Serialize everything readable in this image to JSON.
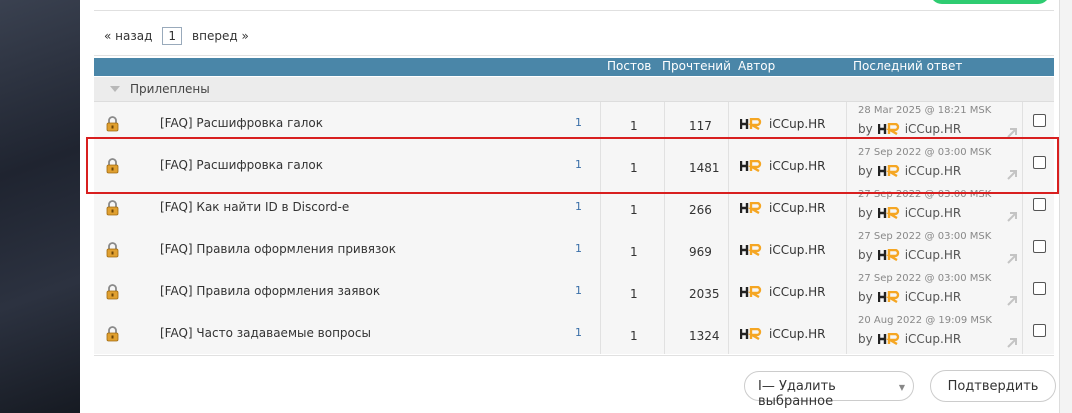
{
  "pager": {
    "prev": "« назад",
    "current": "1",
    "next": "вперед »"
  },
  "table_header": {
    "posts": "Постов",
    "views": "Прочтений",
    "author": "Автор",
    "last_reply": "Последний ответ"
  },
  "group_label": "Прилеплены",
  "rows": [
    {
      "title": "[FAQ] Расшифровка галок",
      "pages": "1",
      "posts": "1",
      "views": "117",
      "author": "iCCup.HR",
      "last_date": "28 Mar 2025 @ 18:21 MSK",
      "by": "by",
      "last_user": "iCCup.HR"
    },
    {
      "title": "[FAQ] Расшифровка галок",
      "pages": "1",
      "posts": "1",
      "views": "1481",
      "author": "iCCup.HR",
      "last_date": "27 Sep 2022 @ 03:00 MSK",
      "by": "by",
      "last_user": "iCCup.HR"
    },
    {
      "title": "[FAQ] Как найти ID в Discord-е",
      "pages": "1",
      "posts": "1",
      "views": "266",
      "author": "iCCup.HR",
      "last_date": "27 Sep 2022 @ 03:00 MSK",
      "by": "by",
      "last_user": "iCCup.HR"
    },
    {
      "title": "[FAQ] Правила оформления привязок",
      "pages": "1",
      "posts": "1",
      "views": "969",
      "author": "iCCup.HR",
      "last_date": "27 Sep 2022 @ 03:00 MSK",
      "by": "by",
      "last_user": "iCCup.HR"
    },
    {
      "title": "[FAQ] Правила оформления заявок",
      "pages": "1",
      "posts": "1",
      "views": "2035",
      "author": "iCCup.HR",
      "last_date": "27 Sep 2022 @ 03:00 MSK",
      "by": "by",
      "last_user": "iCCup.HR"
    },
    {
      "title": "[FAQ] Часто задаваемые вопросы",
      "pages": "1",
      "posts": "1",
      "views": "1324",
      "author": "iCCup.HR",
      "last_date": "20 Aug 2022 @ 19:09 MSK",
      "by": "by",
      "last_user": "iCCup.HR"
    }
  ],
  "actions": {
    "select_value": "I— Удалить выбранное",
    "confirm": "Подтвердить"
  },
  "colors": {
    "header_bg": "#4a86a8",
    "highlight": "#d81f1f",
    "link": "#3a6fa8",
    "logo_orange": "#f5a623"
  }
}
